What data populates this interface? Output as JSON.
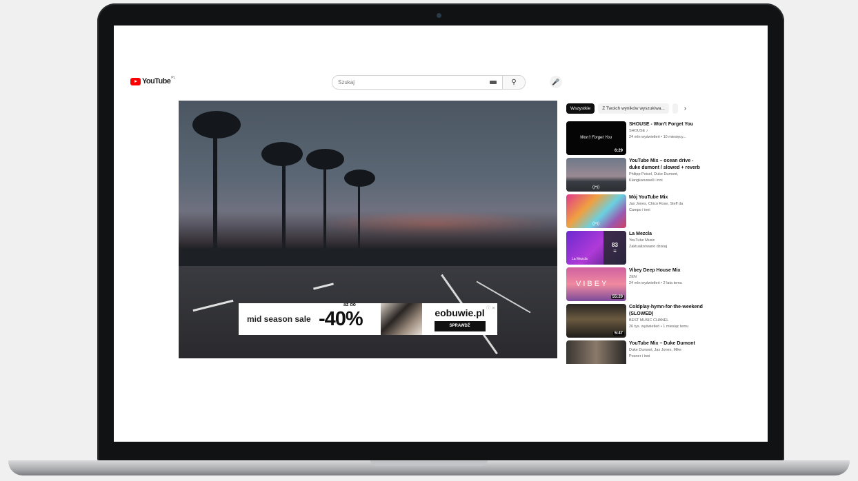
{
  "header": {
    "logo_text": "YouTube",
    "region": "PL",
    "search_placeholder": "Szukaj"
  },
  "ad": {
    "left_text": "mid season sale",
    "upto": "aż do",
    "discount": "-40%",
    "brand": "eobuwie.pl",
    "cta": "SPRAWDŹ"
  },
  "chips": [
    "Wszystkie",
    "Z Twoich wyników wyszukiwa..."
  ],
  "recommendations": [
    {
      "title": "SHOUSE - Won't Forget You",
      "channel": "SHOUSE ♪",
      "meta": "24 mln wyświetleń • 10 miesięcy...",
      "duration": "6:29",
      "thumb_text": "Won't Forget You"
    },
    {
      "title": "YouTube Mix – ocean drive - duke dumont / slowed + reverb",
      "channel": "Philipp Poisel, Duke Dumont,",
      "meta": "Klangkarussell i inni",
      "live": "((•))"
    },
    {
      "title": "Mój YouTube Mix",
      "channel": "Jax Jones, Chico Rose, Steff da",
      "meta": "Campo i inni",
      "live": "((•))"
    },
    {
      "title": "La Mezcla",
      "channel": "YouTube Music",
      "meta": "Zaktualizowano dzisiaj",
      "count": "83",
      "thumb_text": "La Mezcla"
    },
    {
      "title": "Vibey Deep House Mix",
      "channel": "ZEN",
      "meta": "24 mln wyświetleń • 2 lata temu",
      "duration": "55:20",
      "thumb_text": "VIBEY"
    },
    {
      "title": "Coldplay-hymn-for-the-weekend (SLOWED)",
      "channel": "BEST MUSIC CHANEL",
      "meta": "26 tys. wyświetleń • 1 miesiąc temu",
      "duration": "5:47"
    },
    {
      "title": "YouTube Mix – Duke Dumont",
      "channel": "Duke Dumont, Jax Jones, Mike",
      "meta": "Posner i inni"
    }
  ]
}
